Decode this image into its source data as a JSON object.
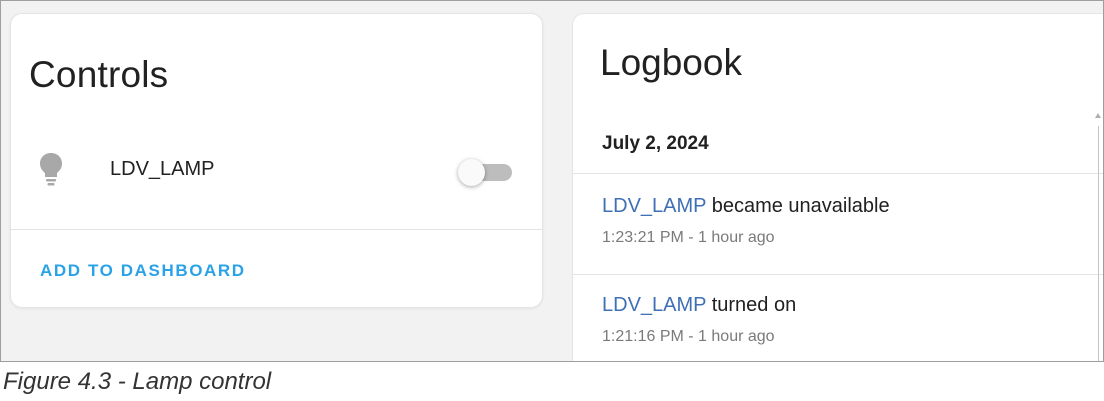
{
  "controls": {
    "title": "Controls",
    "entity_name": "LDV_LAMP",
    "entity_icon": "lightbulb-icon",
    "toggle_state": "off",
    "add_button_label": "ADD TO DASHBOARD"
  },
  "logbook": {
    "title": "Logbook",
    "date": "July 2, 2024",
    "entries": [
      {
        "entity": "LDV_LAMP",
        "message": " became unavailable",
        "time": "1:23:21 PM - 1 hour ago"
      },
      {
        "entity": "LDV_LAMP",
        "message": " turned on",
        "time": "1:21:16 PM - 1 hour ago"
      }
    ]
  },
  "caption": "Figure 4.3 - Lamp control",
  "colors": {
    "accent": "#2aa3e6",
    "entity_link": "#3f6fb5",
    "toggle_track": "#bdbdbd"
  }
}
